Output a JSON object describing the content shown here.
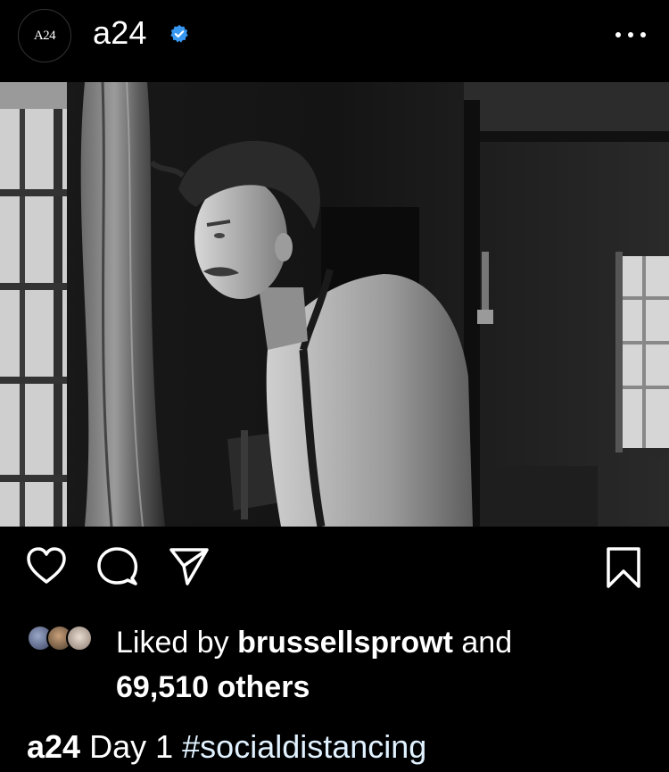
{
  "header": {
    "avatar_text": "A24",
    "username": "a24",
    "verified": true,
    "more_icon": "ellipsis-icon"
  },
  "post": {
    "image_description": "",
    "actions": {
      "like_icon": "heart-icon",
      "comment_icon": "comment-icon",
      "share_icon": "paper-plane-icon",
      "save_icon": "bookmark-icon"
    },
    "likes": {
      "prefix": "Liked by",
      "user": "brussellsprowt",
      "conjunction": "and",
      "count_text": "69,510 others"
    },
    "caption": {
      "user": "a24",
      "text": "Day 1",
      "hashtag": "#socialdistancing"
    }
  },
  "colors": {
    "background": "#000000",
    "text": "#ffffff",
    "verified_badge": "#3897f0",
    "hashtag": "#e0f1ff"
  }
}
